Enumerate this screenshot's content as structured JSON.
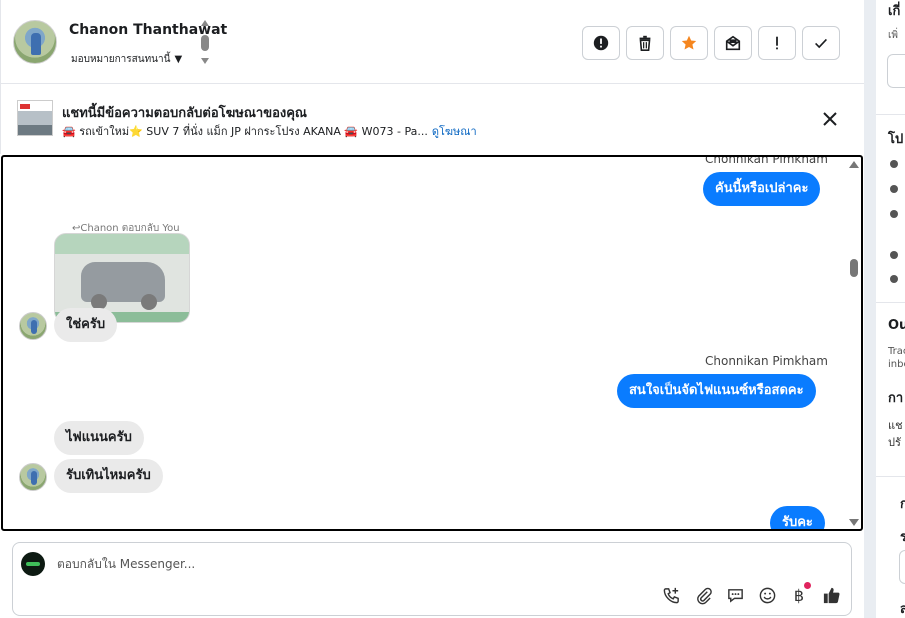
{
  "header": {
    "contact_name": "Chanon Thanthawat",
    "assign_label": "มอบหมายการสนทนานี้",
    "actions": [
      {
        "name": "mark-spam-button",
        "icon": "alert-octagon-icon"
      },
      {
        "name": "delete-button",
        "icon": "trash-icon"
      },
      {
        "name": "star-button",
        "icon": "star-icon"
      },
      {
        "name": "mark-unread-button",
        "icon": "envelope-open-icon"
      },
      {
        "name": "follow-up-button",
        "icon": "exclamation-icon"
      },
      {
        "name": "mark-done-button",
        "icon": "check-icon"
      }
    ]
  },
  "ad": {
    "title": "แชทนี้มีข้อความตอบกลับต่อโฆษณาของคุณ",
    "subtitle": "🚘 รถเข้าใหม่⭐ SUV 7 ที่นั่ง แม็ก JP ฝากระโปรง AKANA 🚘 W073 - Pa...",
    "link": "ดูโฆษณา"
  },
  "messages": {
    "sender_1": "Chonnikan Pimkham",
    "out_1": "คันนี้หรือเปล่าคะ",
    "reply_tag": "↩Chanon ตอบกลับ You",
    "in_1": "ใช่ครับ",
    "sender_2": "Chonnikan Pimkham",
    "out_2": "สนใจเป็นจัดไฟแนนซ์หรือสดคะ",
    "in_2": "ไฟแนนครับ",
    "in_3": "รับเทินไหมครับ",
    "out_3": "รับคะ"
  },
  "composer": {
    "placeholder": "ตอบกลับใน Messenger...",
    "tools": [
      "phone-add-icon",
      "paperclip-icon",
      "chat-bubble-icon",
      "smiley-icon",
      "baht-icon",
      "thumbs-up-icon"
    ],
    "baht_symbol": "฿"
  },
  "right_panel": {
    "h1": "เกี่",
    "s1": "เพิ่",
    "h2": "โป",
    "h3": "Ou",
    "s3a": "Trac",
    "s3b": "inbe",
    "h4": "กา",
    "t4a": "แช",
    "t4b": "ปรั",
    "h5": "ก",
    "h6": "ร",
    "h7": "ส"
  }
}
